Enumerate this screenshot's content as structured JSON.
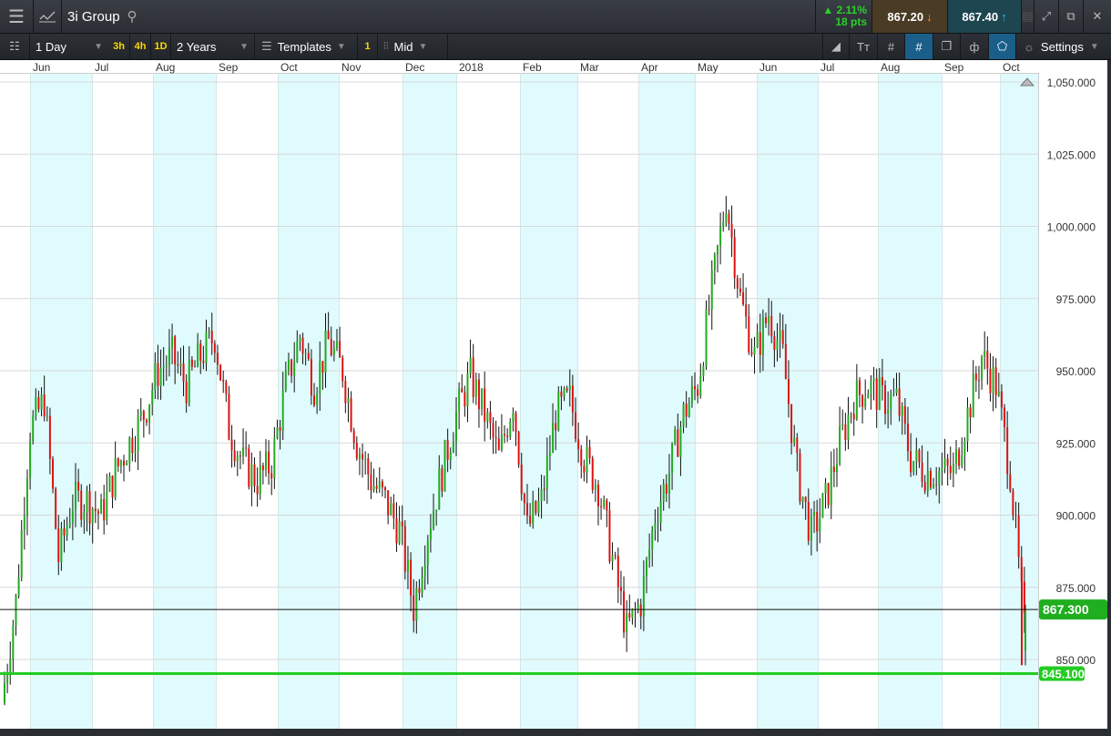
{
  "header": {
    "instrument": "3i Group",
    "change_pct": "2.11%",
    "change_pts": "18 pts",
    "sell_price": "867.20",
    "buy_price": "867.40"
  },
  "toolbar": {
    "interval": "1 Day",
    "quick_intervals": [
      "3h",
      "4h",
      "1D"
    ],
    "range": "2 Years",
    "templates_label": "Templates",
    "templates_count": "1",
    "price_type": "Mid",
    "settings_label": "Settings"
  },
  "colors": {
    "up": "#22aa22",
    "down": "#dd1111",
    "shade": "#e0fbfd",
    "tag": "#1fae1f"
  },
  "chart_data": {
    "type": "candlestick",
    "title": "3i Group",
    "x_tick_labels": [
      "Jun",
      "Jul",
      "Aug",
      "Sep",
      "Oct",
      "Nov",
      "Dec",
      "2018",
      "Feb",
      "Mar",
      "Apr",
      "May",
      "Jun",
      "Jul",
      "Aug",
      "Sep",
      "Oct"
    ],
    "y_tick_labels": [
      "1,050.000",
      "1,025.000",
      "1,000.000",
      "975.000",
      "950.000",
      "925.000",
      "900.000",
      "875.000",
      "850.000"
    ],
    "y_ticks": [
      1050,
      1025,
      1000,
      975,
      950,
      925,
      900,
      875,
      850
    ],
    "ylim": [
      822,
      1058
    ],
    "weekly_closes": [
      835,
      870,
      930,
      940,
      885,
      905,
      905,
      900,
      915,
      925,
      935,
      950,
      955,
      945,
      955,
      962,
      930,
      918,
      912,
      918,
      945,
      962,
      945,
      960,
      950,
      925,
      912,
      905,
      895,
      868,
      895,
      915,
      935,
      948,
      935,
      920,
      940,
      895,
      905,
      935,
      940,
      920,
      910,
      885,
      860,
      870,
      900,
      915,
      935,
      945,
      978,
      1010,
      975,
      955,
      970,
      955,
      915,
      893,
      905,
      925,
      940,
      945,
      940,
      940,
      920,
      915,
      915,
      915,
      935,
      955,
      945,
      915,
      860
    ],
    "last_price": 867.3,
    "last_price_label": "867.300",
    "support_level": 845.1,
    "support_label": "845.100"
  }
}
